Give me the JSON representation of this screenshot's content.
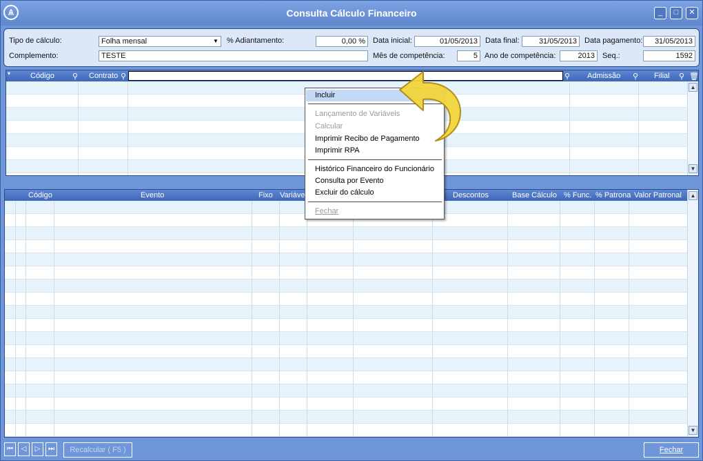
{
  "window": {
    "title": "Consulta Cálculo Financeiro"
  },
  "params": {
    "tipo_calculo_label": "Tipo de cálculo:",
    "tipo_calculo_value": "Folha mensal",
    "adiantamento_label": "% Adiantamento:",
    "adiantamento_value": "0,00 %",
    "data_inicial_label": "Data inicial:",
    "data_inicial_value": "01/05/2013",
    "data_final_label": "Data final:",
    "data_final_value": "31/05/2013",
    "data_pagamento_label": "Data pagamento:",
    "data_pagamento_value": "31/05/2013",
    "complemento_label": "Complemento:",
    "complemento_value": "TESTE",
    "mes_label": "Mês de competência:",
    "mes_value": "5",
    "ano_label": "Ano de competência:",
    "ano_value": "2013",
    "seq_label": "Seq.:",
    "seq_value": "1592"
  },
  "grid1": {
    "columns": [
      "Código",
      "Contrato",
      "Admissão",
      "Filial"
    ]
  },
  "grid2": {
    "columns": [
      "Código",
      "Evento",
      "Fixo",
      "Variáve",
      "Descontos",
      "Base Cálculo",
      "% Func.",
      "% Patrona",
      "Valor Patronal"
    ]
  },
  "context_menu": {
    "items": [
      {
        "label": "Incluir",
        "state": "selected"
      },
      {
        "label": "Lançamento de Variáveis",
        "state": "disabled"
      },
      {
        "label": "Calcular",
        "state": "disabled"
      },
      {
        "label": "Imprimir Recibo de Pagamento",
        "state": "enabled"
      },
      {
        "label": "Imprimir RPA",
        "state": "enabled"
      },
      {
        "label": "Histórico Financeiro do Funcionário",
        "state": "enabled"
      },
      {
        "label": "Consulta por Evento",
        "state": "enabled"
      },
      {
        "label": "Excluir do cálculo",
        "state": "enabled"
      },
      {
        "label": "Fechar",
        "state": "disabled"
      }
    ]
  },
  "footer": {
    "recalcular_label": "Recalcular  ( F5 )",
    "fechar_label": "Fechar",
    "nav": [
      "first",
      "previous",
      "next",
      "last"
    ]
  },
  "colors": {
    "window_bg": "#6f96d8",
    "header_bg": "#3f67b8",
    "row_alt": "#e6f3fa",
    "menu_selected": "#c4d9f5",
    "pointer_arrow": "#f2d53c"
  }
}
